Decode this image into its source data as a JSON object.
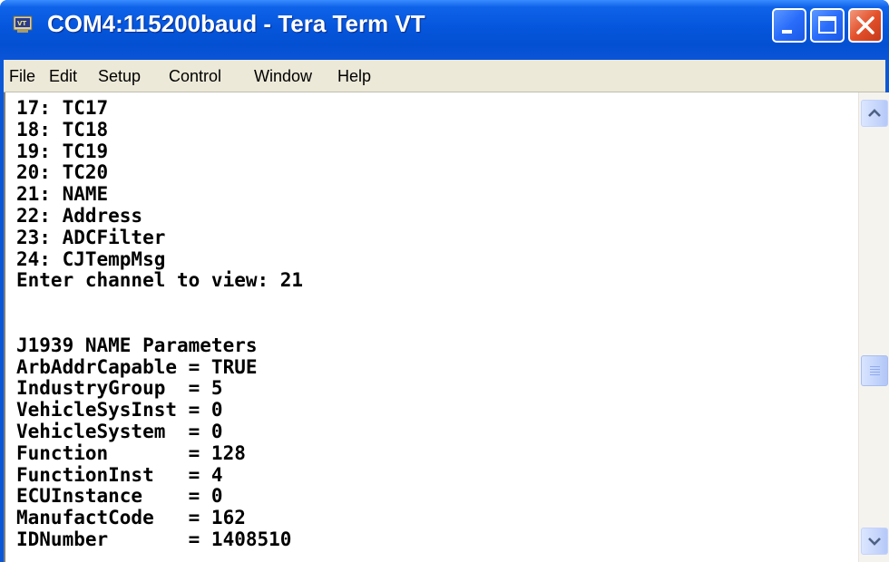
{
  "window": {
    "title": "COM4:115200baud - Tera Term VT",
    "icon": "teraterm-app-icon",
    "controls": {
      "minimize": "minimize-icon",
      "maximize": "maximize-icon",
      "close": "close-icon"
    }
  },
  "menu": {
    "items": [
      {
        "label": "File"
      },
      {
        "label": "Edit"
      },
      {
        "label": "Setup"
      },
      {
        "label": "Control"
      },
      {
        "label": "Window"
      },
      {
        "label": "Help"
      }
    ]
  },
  "terminal": {
    "lines": [
      "17: TC17",
      "18: TC18",
      "19: TC19",
      "20: TC20",
      "21: NAME",
      "22: Address",
      "23: ADCFilter",
      "24: CJTempMsg",
      "Enter channel to view: 21",
      "",
      "",
      "J1939 NAME Parameters",
      "ArbAddrCapable = TRUE",
      "IndustryGroup  = 5",
      "VehicleSysInst = 0",
      "VehicleSystem  = 0",
      "Function       = 128",
      "FunctionInst   = 4",
      "ECUInstance    = 0",
      "ManufactCode   = 162",
      "IDNumber       = 1408510"
    ]
  },
  "scrollbar": {
    "up_icon": "arrow-up-icon",
    "down_icon": "arrow-down-icon",
    "position": 0.62
  },
  "colors": {
    "titlebar": "#0556dc",
    "menubar": "#ece9d8",
    "terminal_bg": "#ffffff",
    "terminal_fg": "#000000",
    "close_button": "#e3512b"
  }
}
